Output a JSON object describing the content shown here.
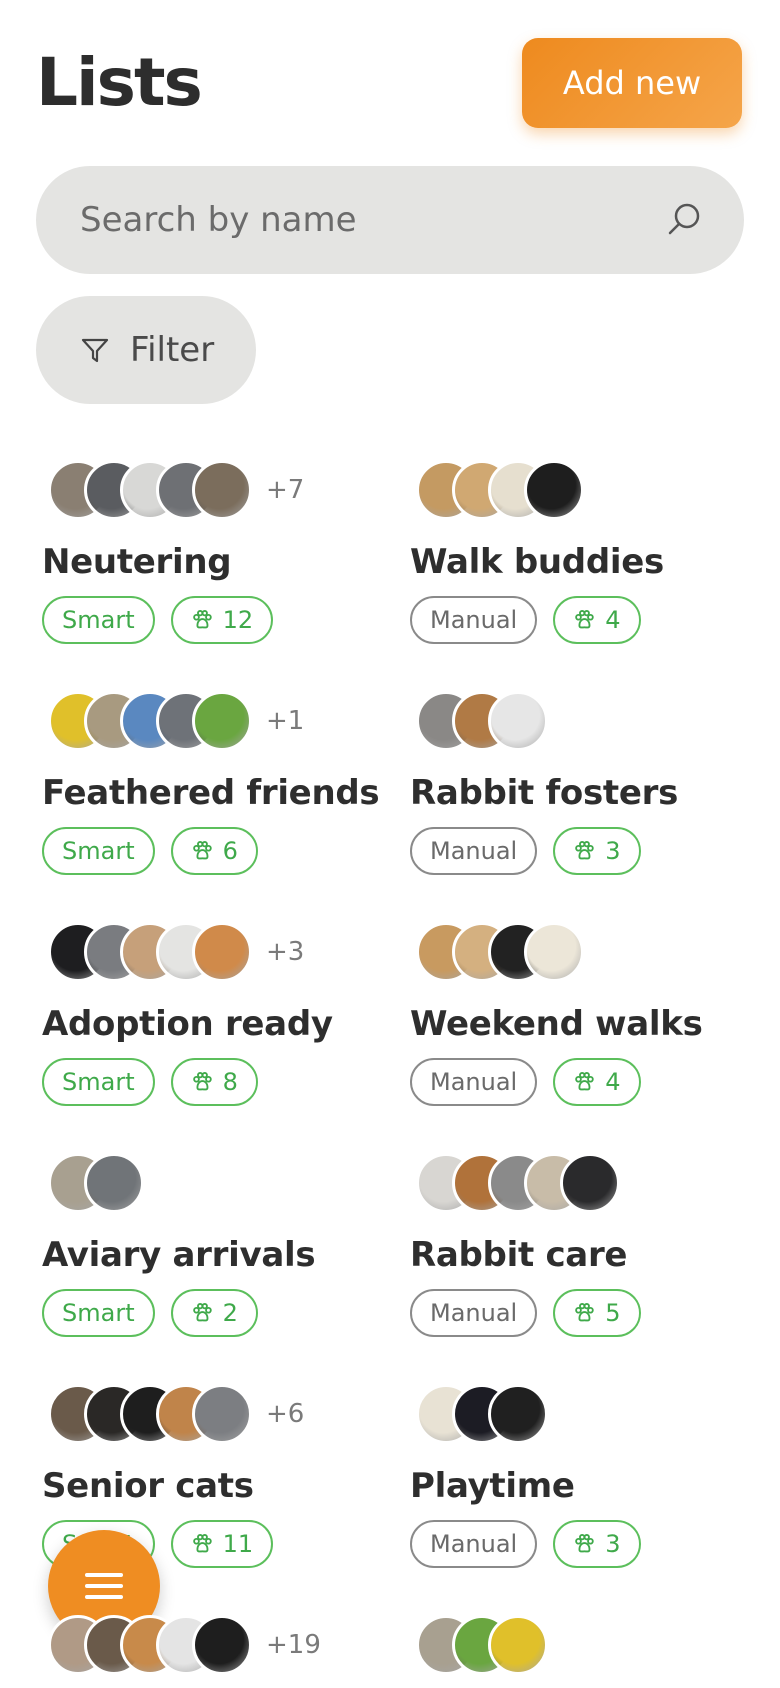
{
  "header": {
    "title": "Lists",
    "add_button": "Add new"
  },
  "search": {
    "placeholder": "Search by name"
  },
  "filter": {
    "label": "Filter"
  },
  "lists": [
    {
      "name": "Neutering",
      "type": "Smart",
      "count": "12",
      "extra": "+7",
      "avatars": [
        "#8a7f72",
        "#5a5c60",
        "#d8d8d6",
        "#6e7074",
        "#7b6d5c"
      ]
    },
    {
      "name": "Walk buddies",
      "type": "Manual",
      "count": "4",
      "extra": "",
      "avatars": [
        "#c49a62",
        "#d0a872",
        "#e6dfcf",
        "#1e1e1e"
      ]
    },
    {
      "name": "Feathered friends",
      "type": "Smart",
      "count": "6",
      "extra": "+1",
      "avatars": [
        "#e0c02a",
        "#a89a80",
        "#5a88c0",
        "#6e7278",
        "#6aa640"
      ]
    },
    {
      "name": "Rabbit fosters",
      "type": "Manual",
      "count": "3",
      "extra": "",
      "avatars": [
        "#8a8886",
        "#b07a45",
        "#e6e6e6"
      ]
    },
    {
      "name": "Adoption ready",
      "type": "Smart",
      "count": "8",
      "extra": "+3",
      "avatars": [
        "#1e1e20",
        "#7a7c80",
        "#c6a07a",
        "#e4e4e2",
        "#d08a4a"
      ]
    },
    {
      "name": "Weekend walks",
      "type": "Manual",
      "count": "4",
      "extra": "",
      "avatars": [
        "#c89a60",
        "#d4b080",
        "#222222",
        "#ece6d8"
      ]
    },
    {
      "name": "Aviary arrivals",
      "type": "Smart",
      "count": "2",
      "extra": "",
      "avatars": [
        "#a8a090",
        "#707478"
      ]
    },
    {
      "name": "Rabbit care",
      "type": "Manual",
      "count": "5",
      "extra": "",
      "avatars": [
        "#d8d6d2",
        "#b0723a",
        "#8a8a8a",
        "#c8bca8",
        "#2a2a2c"
      ]
    },
    {
      "name": "Senior cats",
      "type": "Smart",
      "count": "11",
      "extra": "+6",
      "avatars": [
        "#6a5a4a",
        "#2a2826",
        "#1e1e1e",
        "#c0844a",
        "#7c7e82"
      ]
    },
    {
      "name": "Playtime",
      "type": "Manual",
      "count": "3",
      "extra": "",
      "avatars": [
        "#e8e2d4",
        "#1c1c24",
        "#202020"
      ]
    },
    {
      "name": "",
      "type": "",
      "count": "",
      "extra": "+19",
      "avatars": [
        "#b09a86",
        "#6a5a4a",
        "#c88a4a",
        "#e4e4e4",
        "#1e1e1e"
      ]
    },
    {
      "name": "",
      "type": "",
      "count": "",
      "extra": "",
      "avatars": [
        "#a8a090",
        "#6aa640",
        "#e0c02a"
      ]
    }
  ],
  "colors": {
    "accent": "#ef8d22",
    "smart": "#3fa94a",
    "manual": "#6a6a6a"
  },
  "icons": {
    "search": "search-icon",
    "filter": "filter-icon",
    "count": "paw-icon",
    "menu": "menu-icon"
  }
}
